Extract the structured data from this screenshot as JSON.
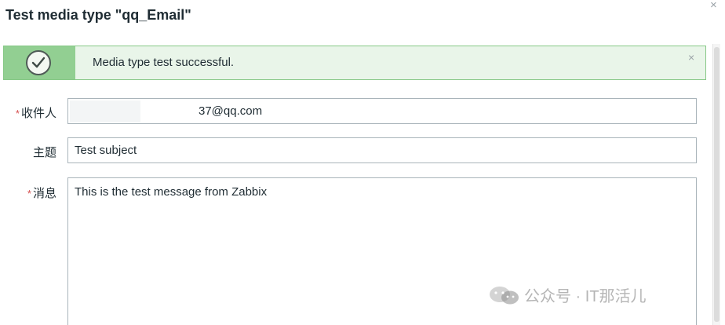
{
  "dialog": {
    "title": "Test media type \"qq_Email\"",
    "close_glyph": "×"
  },
  "message": {
    "text": "Media type test successful.",
    "icon": "check-circle-icon",
    "close_glyph": "×",
    "status_color": "#92cf92"
  },
  "form": {
    "recipient": {
      "label": "收件人",
      "required_mark": "*",
      "value": "37@qq.com"
    },
    "subject": {
      "label": "主题",
      "value": "Test subject"
    },
    "message": {
      "label": "消息",
      "required_mark": "*",
      "value": "This is the test message from Zabbix"
    }
  },
  "watermark": {
    "text": "公众号 · IT那活儿"
  }
}
